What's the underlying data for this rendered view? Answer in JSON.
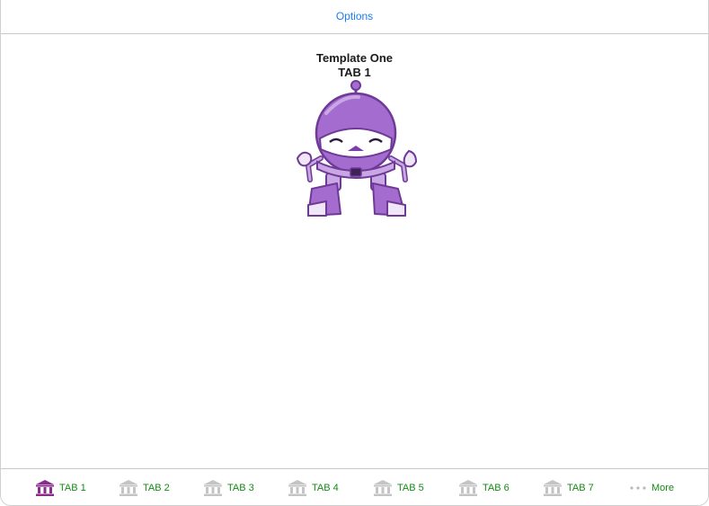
{
  "navbar": {
    "options_label": "Options"
  },
  "content": {
    "title": "Template One",
    "subtitle": "TAB 1"
  },
  "colors": {
    "accent_blue": "#1a7cf0",
    "tab_label_green": "#158a15",
    "selected_icon_purple": "#8a2c8e",
    "unselected_icon_gray": "#c4c4c4",
    "robot_purple": "#9a5fc0"
  },
  "tabbar": {
    "tabs": [
      {
        "label": "TAB 1",
        "icon": "bank-icon",
        "selected": true
      },
      {
        "label": "TAB 2",
        "icon": "bank-icon",
        "selected": false
      },
      {
        "label": "TAB 3",
        "icon": "bank-icon",
        "selected": false
      },
      {
        "label": "TAB 4",
        "icon": "bank-icon",
        "selected": false
      },
      {
        "label": "TAB 5",
        "icon": "bank-icon",
        "selected": false
      },
      {
        "label": "TAB 6",
        "icon": "bank-icon",
        "selected": false
      },
      {
        "label": "TAB 7",
        "icon": "bank-icon",
        "selected": false
      }
    ],
    "more_label": "More",
    "more_icon": "more-dots-icon"
  }
}
